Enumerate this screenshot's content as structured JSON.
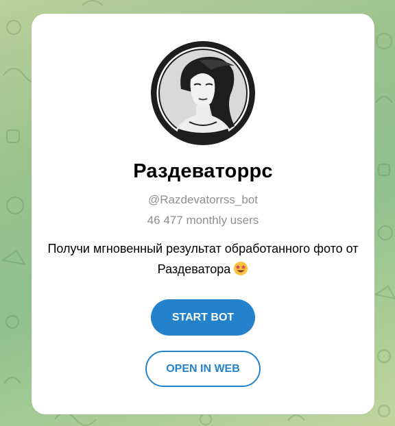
{
  "bot": {
    "name": "Раздеваторрс",
    "username": "@Razdevatorrss_bot",
    "monthly_users": "46 477 monthly users",
    "description": "Получи мгновенный результат обработанного фото от Раздеватора",
    "description_emoji": "star-struck-emoji"
  },
  "buttons": {
    "start_label": "START BOT",
    "web_label": "OPEN IN WEB"
  },
  "colors": {
    "accent": "#2481cc",
    "secondary_text": "#8e8e93",
    "background_green": "#9cc38d"
  },
  "icons": {
    "avatar": "bot-avatar-icon"
  }
}
